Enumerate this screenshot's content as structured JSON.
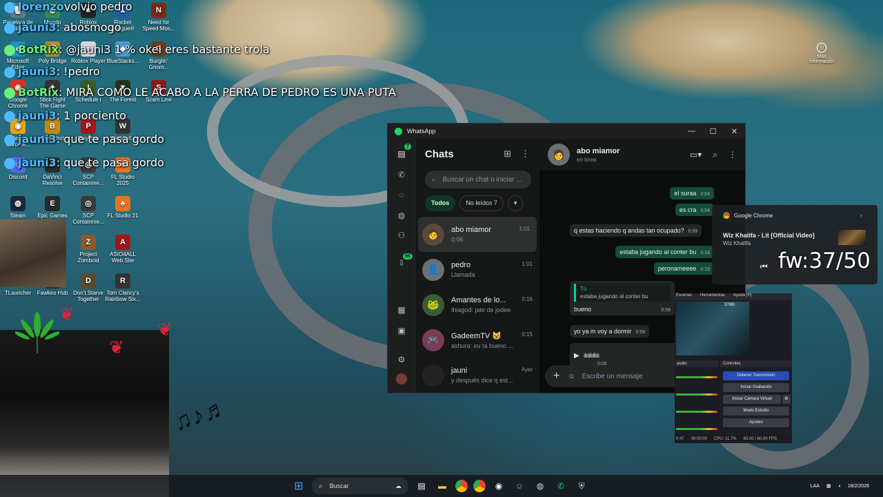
{
  "desktop": {
    "icons": [
      {
        "label": "Papelera de reciclaje",
        "glyph": "🗑",
        "color": "#5a7a8c"
      },
      {
        "label": "Mundo",
        "glyph": "◍",
        "color": "#2d8f4e"
      },
      {
        "label": "Roblox",
        "glyph": "■",
        "color": "#222"
      },
      {
        "label": "Rocket League®",
        "glyph": "▲",
        "color": "#1f5fa8"
      },
      {
        "label": "Need for Speed Mos...",
        "glyph": "N",
        "color": "#7a2a15"
      },
      {
        "label": "Microsoft Edge",
        "glyph": "e",
        "color": "#1b8fd2"
      },
      {
        "label": "Poly Bridge",
        "glyph": "⌒",
        "color": "#b88c2a"
      },
      {
        "label": "Roblox Player",
        "glyph": "■",
        "color": "#d9d9d9"
      },
      {
        "label": "BlueStacks...",
        "glyph": "◆",
        "color": "#4a9bd6"
      },
      {
        "label": "Burglin' Gnom...",
        "glyph": "G",
        "color": "#6b3d1d"
      },
      {
        "label": "Google Chrome",
        "glyph": "◉",
        "color": "#d93025"
      },
      {
        "label": "Stick Fight The Game",
        "glyph": "✦",
        "color": "#333"
      },
      {
        "label": "Schedule I",
        "glyph": "I",
        "color": "#3a5a2a"
      },
      {
        "label": "The Forest",
        "glyph": "▼",
        "color": "#24331f"
      },
      {
        "label": "Scam Line",
        "glyph": "S",
        "color": "#8a1c1c"
      },
      {
        "label": "Steam Chrome...",
        "glyph": "◉",
        "color": "#e8a317"
      },
      {
        "label": "Betterfort",
        "glyph": "B",
        "color": "#c48a10"
      },
      {
        "label": "Playtime",
        "glyph": "P",
        "color": "#a01818"
      },
      {
        "label": "World of...",
        "glyph": "W",
        "color": "#333"
      },
      {
        "label": "Discord",
        "glyph": "☺",
        "color": "#5865f2"
      },
      {
        "label": "DaVinci Resolve",
        "glyph": "◐",
        "color": "#2a2a2a"
      },
      {
        "label": "SCP Containme...",
        "glyph": "◎",
        "color": "#3a3a3a"
      },
      {
        "label": "FL Studio 2025",
        "glyph": "♣",
        "color": "#e8731b"
      },
      {
        "label": "Steam",
        "glyph": "◍",
        "color": "#1b2838"
      },
      {
        "label": "Epic Games",
        "glyph": "E",
        "color": "#2a2a2a"
      },
      {
        "label": "SCP Containme...",
        "glyph": "◎",
        "color": "#3a3a3a"
      },
      {
        "label": "FL Studio 21",
        "glyph": "♣",
        "color": "#e8731b"
      },
      {
        "label": "Project Zomboid",
        "glyph": "Z",
        "color": "#8a5a2a"
      },
      {
        "label": "ASIO4ALL Web Site",
        "glyph": "A",
        "color": "#a01818"
      },
      {
        "label": "TLauncher",
        "glyph": "T",
        "color": "#2c6e2c"
      },
      {
        "label": "Fawkes Hub",
        "glyph": "F",
        "color": "#3a2a1a"
      },
      {
        "label": "Don't Starve Together",
        "glyph": "D",
        "color": "#5a4a2a"
      },
      {
        "label": "Tom Clancy's Rainbow Six...",
        "glyph": "R",
        "color": "#333"
      }
    ],
    "more_info": "Más información"
  },
  "stream_chat": [
    {
      "user": "lorenzo",
      "text": "volvio pedro",
      "user_color": "#4fb8ff"
    },
    {
      "user": "jauni3",
      "text": ": abosmogo",
      "user_color": "#4fb8ff"
    },
    {
      "user": "BotRix",
      "text": ": @jauni3 1 % okei eres bastante trola",
      "user_color": "#6cf07a"
    },
    {
      "user": "jauni3",
      "text": ": !pedro",
      "user_color": "#4fb8ff"
    },
    {
      "user": "BotRix",
      "text": ": MIRA COMO LE ACABO A LA PERRA DE PEDRO ES UNA PUTA",
      "user_color": "#6cf07a"
    },
    {
      "user": "jauni3",
      "text": ": 1 porciento",
      "user_color": "#4fb8ff"
    },
    {
      "user": "jauni3",
      "text": ": que te pasa gordo",
      "user_color": "#4fb8ff"
    },
    {
      "user": "jauni3",
      "text": ": que te pasa gordo",
      "user_color": "#4fb8ff"
    }
  ],
  "whatsapp": {
    "window_title": "WhatsApp",
    "window_controls": [
      "—",
      "☐",
      "✕"
    ],
    "rail_badges": {
      "chats": "7",
      "status": "95"
    },
    "list_title": "Chats",
    "search_placeholder": "Buscar un chat o iniciar ...",
    "filters": {
      "all": "Todos",
      "unread": "No leídos 7"
    },
    "chats": [
      {
        "name": "abo miamor",
        "time": "1:01",
        "preview": "0:06",
        "avatar": "🧑"
      },
      {
        "name": "pedro",
        "time": "1:01",
        "preview": "Llamada",
        "avatar": "👤"
      },
      {
        "name": "Amantes de lo...",
        "time": "0:16",
        "preview": "thiagod: jate de jodee",
        "avatar": "🐸"
      },
      {
        "name": "GadeemTV 😺",
        "time": "0:15",
        "preview": "ashura: eu ta bueno ...",
        "avatar": "🎮"
      },
      {
        "name": "jauni",
        "time": "Ayer",
        "preview": "y después dice q est...",
        "avatar": ""
      }
    ],
    "conversation": {
      "contact": "abo miamor",
      "status": "en línea",
      "messages": [
        {
          "dir": "out",
          "text": "el suraa",
          "time": "0:04"
        },
        {
          "dir": "out",
          "text": "es cra",
          "time": "0:04"
        },
        {
          "dir": "in",
          "text": "q estas haciendo q andas tan ocupado?",
          "time": "0:09"
        },
        {
          "dir": "out",
          "text": "estaba jugando al conter bu",
          "time": "0:18"
        },
        {
          "dir": "out",
          "text": "peronameeee",
          "time": "0:18"
        },
        {
          "dir": "in",
          "text": "bueno",
          "time": "0:58"
        },
        {
          "dir": "in",
          "text": "yo ya m voy a dormir",
          "time": "0:58"
        }
      ],
      "quote": {
        "author": "Tú",
        "text": "estaba jugando al conter bu"
      },
      "voice_duration": "0:06",
      "compose_placeholder": "Escribe un mensaje"
    }
  },
  "media_notification": {
    "source": "Google Chrome",
    "title": "Wiz Khalifa - Lit [Official Video]",
    "artist": "Wiz Khalifa"
  },
  "stream_overlay": {
    "fw": "fw:37/50"
  },
  "obs": {
    "menu": [
      "Escenas",
      "Herramientas",
      "Ayuda (H)"
    ],
    "preview_label": "37/60",
    "audio_head": "audio",
    "controls_head": "Controles",
    "buttons": [
      "Detener Transmisión",
      "Iniciar Grabación",
      "Iniciar Cámara Virtual",
      "Modo Estudio",
      "Ajustes"
    ],
    "status": [
      "0:47",
      "00:00:00",
      "CPU: 11.7%",
      "60.00 / 60.00 FPS"
    ]
  },
  "taskbar": {
    "search": "Buscar",
    "tray_lang": "LAA",
    "date": "18/2/2026"
  }
}
